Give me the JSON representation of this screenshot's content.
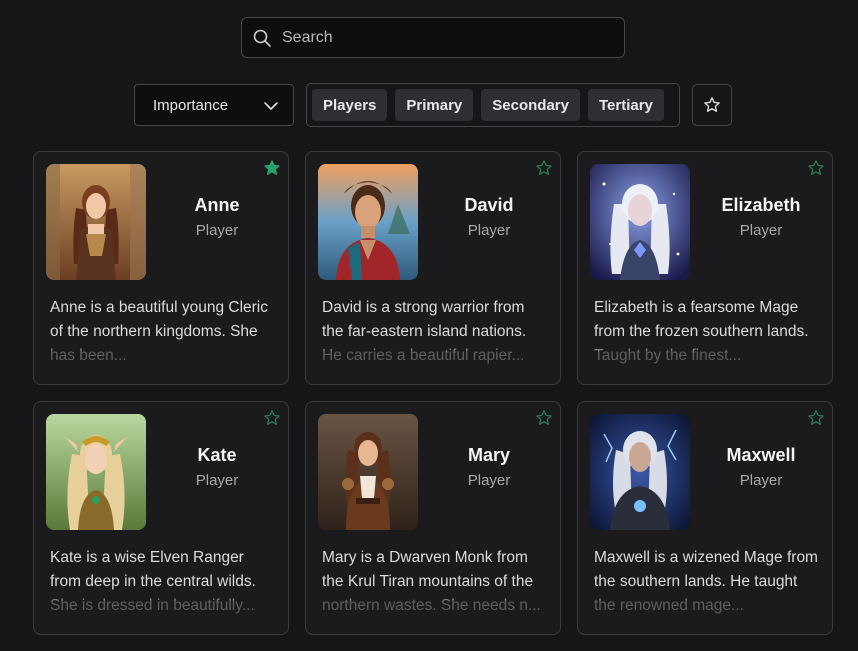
{
  "search": {
    "placeholder": "Search",
    "icon": "search-icon"
  },
  "sort": {
    "selected": "Importance",
    "icon": "chevron-down-icon"
  },
  "filters": [
    {
      "label": "Players"
    },
    {
      "label": "Primary"
    },
    {
      "label": "Secondary"
    },
    {
      "label": "Tertiary"
    }
  ],
  "favorites_filter": {
    "icon": "star-outline-icon"
  },
  "colors": {
    "favorite_star": "#26a269",
    "star_outline": "#2e7d5a"
  },
  "characters": [
    {
      "name": "Anne",
      "role": "Player",
      "favorite": true,
      "description": "Anne is a beautiful young Cleric of the northern kingdoms. She has been..."
    },
    {
      "name": "David",
      "role": "Player",
      "favorite": false,
      "description": "David is a strong warrior from the far-eastern island nations. He carries a beautiful rapier..."
    },
    {
      "name": "Elizabeth",
      "role": "Player",
      "favorite": false,
      "description": "Elizabeth is a fearsome Mage from the frozen southern lands. Taught by the finest..."
    },
    {
      "name": "Kate",
      "role": "Player",
      "favorite": false,
      "description": "Kate is a wise Elven Ranger from deep in the central wilds. She is dressed in beautifully..."
    },
    {
      "name": "Mary",
      "role": "Player",
      "favorite": false,
      "description": "Mary is a Dwarven Monk from the Krul Tiran mountains of the northern wastes. She needs n..."
    },
    {
      "name": "Maxwell",
      "role": "Player",
      "favorite": false,
      "description": "Maxwell is a wizened Mage from the southern lands. He taught the renowned mage..."
    }
  ]
}
